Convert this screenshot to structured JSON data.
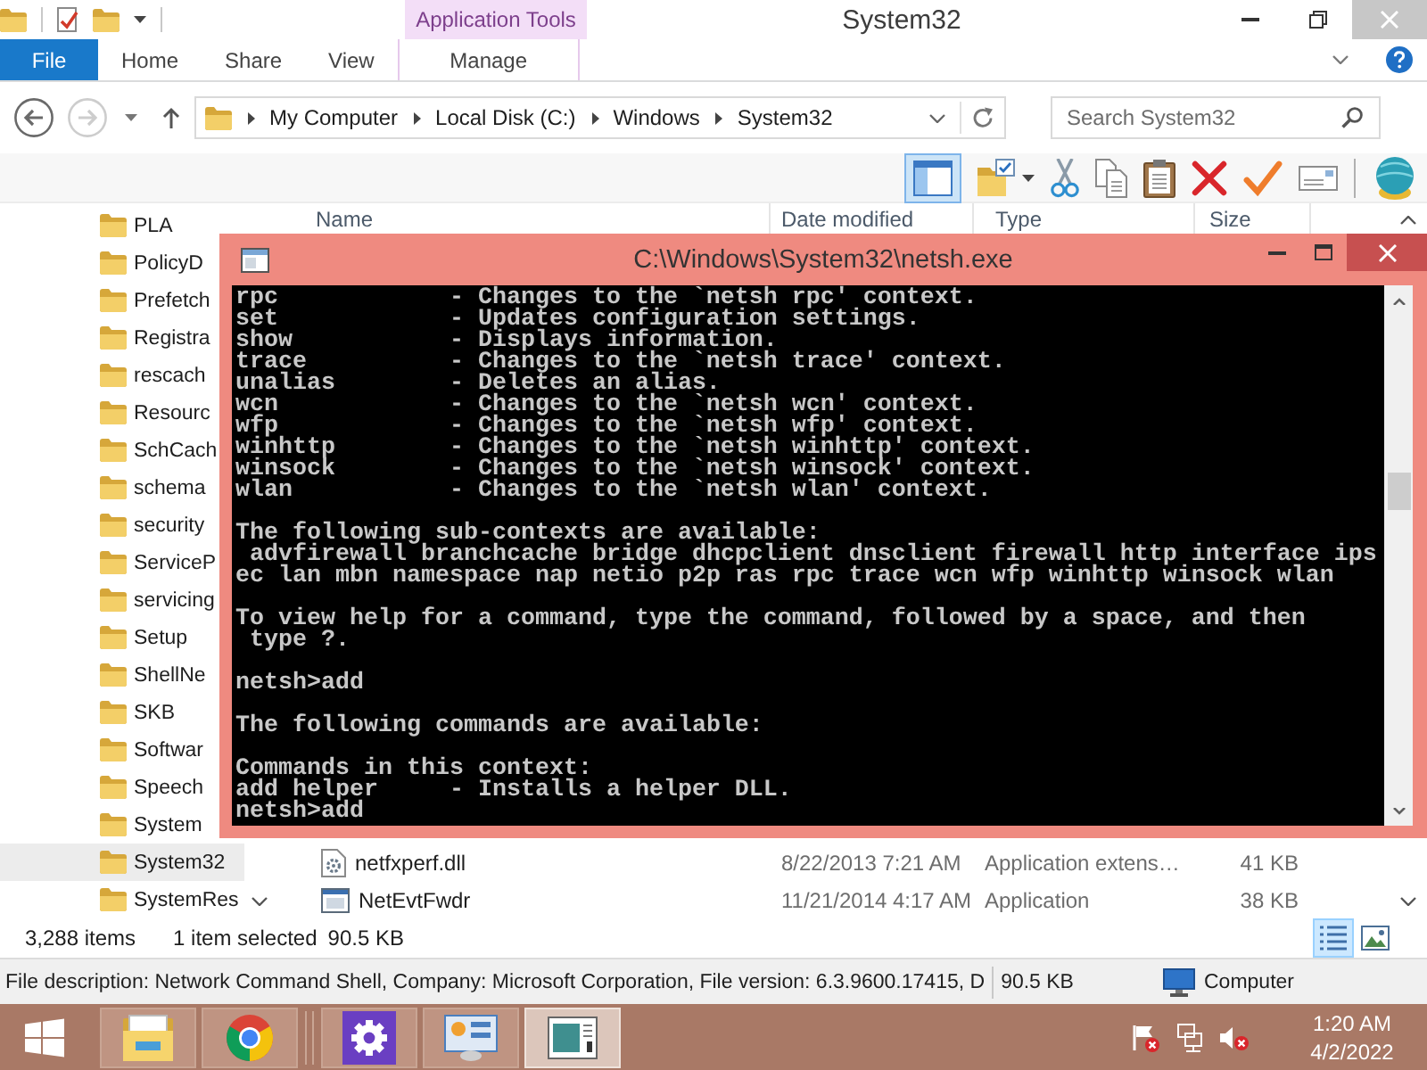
{
  "window": {
    "title": "System32"
  },
  "ribbon": {
    "context_group": "Application Tools",
    "tabs": [
      {
        "label": "File",
        "kind": "file"
      },
      {
        "label": "Home",
        "kind": "tab"
      },
      {
        "label": "Share",
        "kind": "tab"
      },
      {
        "label": "View",
        "kind": "tab"
      },
      {
        "label": "Manage",
        "kind": "context"
      }
    ]
  },
  "navigation": {
    "back": {
      "disabled": false
    },
    "forward": {
      "disabled": true
    }
  },
  "address_bar": {
    "breadcrumbs": [
      "My Computer",
      "Local Disk (C:)",
      "Windows",
      "System32"
    ]
  },
  "search": {
    "placeholder": "Search System32"
  },
  "toolbar": {
    "buttons": [
      {
        "selected": true
      },
      {
        "selected": false
      },
      {
        "selected": false
      },
      {
        "selected": false
      },
      {
        "selected": false
      },
      {
        "selected": false
      },
      {
        "selected": false
      },
      {
        "selected": false
      },
      {
        "selected": false
      }
    ]
  },
  "nav_pane": {
    "items": [
      {
        "label": "PLA",
        "selected": false
      },
      {
        "label": "PolicyD",
        "selected": false
      },
      {
        "label": "Prefetch",
        "selected": false
      },
      {
        "label": "Registra",
        "selected": false
      },
      {
        "label": "rescach",
        "selected": false
      },
      {
        "label": "Resourc",
        "selected": false
      },
      {
        "label": "SchCach",
        "selected": false
      },
      {
        "label": "schema",
        "selected": false
      },
      {
        "label": "security",
        "selected": false
      },
      {
        "label": "ServiceP",
        "selected": false
      },
      {
        "label": "servicing",
        "selected": false
      },
      {
        "label": "Setup",
        "selected": false
      },
      {
        "label": "ShellNe",
        "selected": false
      },
      {
        "label": "SKB",
        "selected": false
      },
      {
        "label": "Softwar",
        "selected": false
      },
      {
        "label": "Speech",
        "selected": false
      },
      {
        "label": "System",
        "selected": false
      },
      {
        "label": "System32",
        "selected": true
      },
      {
        "label": "SystemRes",
        "selected": false
      }
    ]
  },
  "file_list": {
    "columns": [
      "Name",
      "Date modified",
      "Type",
      "Size"
    ],
    "rows": [
      {
        "kind": "dll",
        "name": "netfxperf.dll",
        "date": "8/22/2013 7:21 AM",
        "type": "Application extens…",
        "size": "41 KB"
      },
      {
        "kind": "exe",
        "name": "NetEvtFwdr",
        "date": "11/21/2014 4:17 AM",
        "type": "Application",
        "size": "38 KB"
      }
    ]
  },
  "status_bar": {
    "item_count": "3,288 items",
    "selection": "1 item selected",
    "selection_size": "90.5 KB",
    "views": [
      {
        "selected": true
      },
      {
        "selected": false
      }
    ]
  },
  "details_bar": {
    "description": "File description: Network Command Shell, Company: Microsoft Corporation, File version: 6.3.9600.17415, D",
    "size": "90.5 KB",
    "location": "Computer"
  },
  "console": {
    "title": "C:\\Windows\\System32\\netsh.exe",
    "lines": [
      {
        "kind": "command",
        "command": "rpc",
        "description": "- Changes to the `netsh rpc' context."
      },
      {
        "kind": "command",
        "command": "set",
        "description": "- Updates configuration settings."
      },
      {
        "kind": "command",
        "command": "show",
        "description": "- Displays information."
      },
      {
        "kind": "command",
        "command": "trace",
        "description": "- Changes to the `netsh trace' context."
      },
      {
        "kind": "command",
        "command": "unalias",
        "description": "- Deletes an alias."
      },
      {
        "kind": "command",
        "command": "wcn",
        "description": "- Changes to the `netsh wcn' context."
      },
      {
        "kind": "command",
        "command": "wfp",
        "description": "- Changes to the `netsh wfp' context."
      },
      {
        "kind": "command",
        "command": "winhttp",
        "description": "- Changes to the `netsh winhttp' context."
      },
      {
        "kind": "command",
        "command": "winsock",
        "description": "- Changes to the `netsh winsock' context."
      },
      {
        "kind": "command",
        "command": "wlan",
        "description": "- Changes to the `netsh wlan' context."
      },
      {
        "kind": "blank"
      },
      {
        "kind": "text",
        "text": "The following sub-contexts are available:"
      },
      {
        "kind": "text",
        "text": " advfirewall branchcache bridge dhcpclient dnsclient firewall http interface ips"
      },
      {
        "kind": "text",
        "text": "ec lan mbn namespace nap netio p2p ras rpc trace wcn wfp winhttp winsock wlan"
      },
      {
        "kind": "blank"
      },
      {
        "kind": "text",
        "text": "To view help for a command, type the command, followed by a space, and then"
      },
      {
        "kind": "text",
        "text": " type ?."
      },
      {
        "kind": "blank"
      },
      {
        "kind": "text",
        "text": "netsh>add"
      },
      {
        "kind": "blank"
      },
      {
        "kind": "text",
        "text": "The following commands are available:"
      },
      {
        "kind": "blank"
      },
      {
        "kind": "text",
        "text": "Commands in this context:"
      },
      {
        "kind": "command",
        "command": "add helper",
        "description": "- Installs a helper DLL."
      },
      {
        "kind": "text",
        "text": "netsh>add"
      }
    ]
  },
  "taskbar": {
    "apps": [
      {
        "selected": false
      },
      {
        "selected": false
      },
      {
        "selected": false
      },
      {
        "selected": false
      },
      {
        "selected": true
      }
    ],
    "clock": {
      "time": "1:20 AM",
      "date": "4/2/2022"
    }
  }
}
